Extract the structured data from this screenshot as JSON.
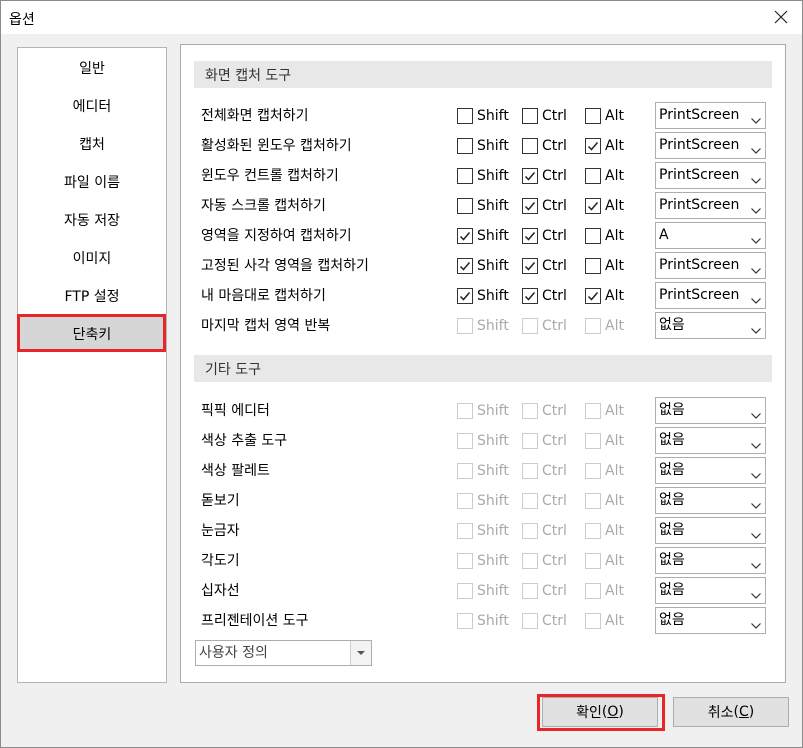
{
  "window": {
    "title": "옵션",
    "close_label": "✕"
  },
  "sidebar": {
    "items": [
      {
        "label": "일반"
      },
      {
        "label": "에디터"
      },
      {
        "label": "캡처"
      },
      {
        "label": "파일 이름"
      },
      {
        "label": "자동 저장"
      },
      {
        "label": "이미지"
      },
      {
        "label": "FTP 설정"
      },
      {
        "label": "단축키",
        "selected": true
      }
    ]
  },
  "capture_section": {
    "title": "화면 캡처 도구",
    "rows": [
      {
        "label": "전체화면 캡처하기",
        "shift": false,
        "ctrl": false,
        "alt": false,
        "key": "PrintScreen",
        "enabled": true
      },
      {
        "label": "활성화된 윈도우 캡처하기",
        "shift": false,
        "ctrl": false,
        "alt": true,
        "key": "PrintScreen",
        "enabled": true
      },
      {
        "label": "윈도우 컨트롤 캡처하기",
        "shift": false,
        "ctrl": true,
        "alt": false,
        "key": "PrintScreen",
        "enabled": true
      },
      {
        "label": "자동 스크롤 캡처하기",
        "shift": false,
        "ctrl": true,
        "alt": true,
        "key": "PrintScreen",
        "enabled": true
      },
      {
        "label": "영역을 지정하여 캡처하기",
        "shift": true,
        "ctrl": true,
        "alt": false,
        "key": "A",
        "enabled": true
      },
      {
        "label": "고정된 사각 영역을 캡처하기",
        "shift": true,
        "ctrl": true,
        "alt": false,
        "key": "PrintScreen",
        "enabled": true
      },
      {
        "label": "내 마음대로 캡처하기",
        "shift": true,
        "ctrl": true,
        "alt": true,
        "key": "PrintScreen",
        "enabled": true
      },
      {
        "label": "마지막 캡처 영역 반복",
        "shift": false,
        "ctrl": false,
        "alt": false,
        "key": "없음",
        "enabled": false
      }
    ]
  },
  "other_section": {
    "title": "기타 도구",
    "rows": [
      {
        "label": "픽픽 에디터",
        "key": "없음",
        "enabled": false
      },
      {
        "label": "색상 추출 도구",
        "key": "없음",
        "enabled": false
      },
      {
        "label": "색상 팔레트",
        "key": "없음",
        "enabled": false
      },
      {
        "label": "돋보기",
        "key": "없음",
        "enabled": false
      },
      {
        "label": "눈금자",
        "key": "없음",
        "enabled": false
      },
      {
        "label": "각도기",
        "key": "없음",
        "enabled": false
      },
      {
        "label": "십자선",
        "key": "없음",
        "enabled": false
      },
      {
        "label": "프리젠테이션 도구",
        "key": "없음",
        "enabled": false
      }
    ]
  },
  "modifiers": {
    "shift": "Shift",
    "ctrl": "Ctrl",
    "alt": "Alt"
  },
  "custom_combo": {
    "value": "사용자 정의"
  },
  "buttons": {
    "ok_label": "확인",
    "ok_mnemonic": "O",
    "cancel_label": "취소",
    "cancel_mnemonic": "C"
  },
  "colors": {
    "highlight_red": "#e8262a",
    "selected_bg": "#d6d6d6",
    "section_bg": "#e8e8e8"
  }
}
